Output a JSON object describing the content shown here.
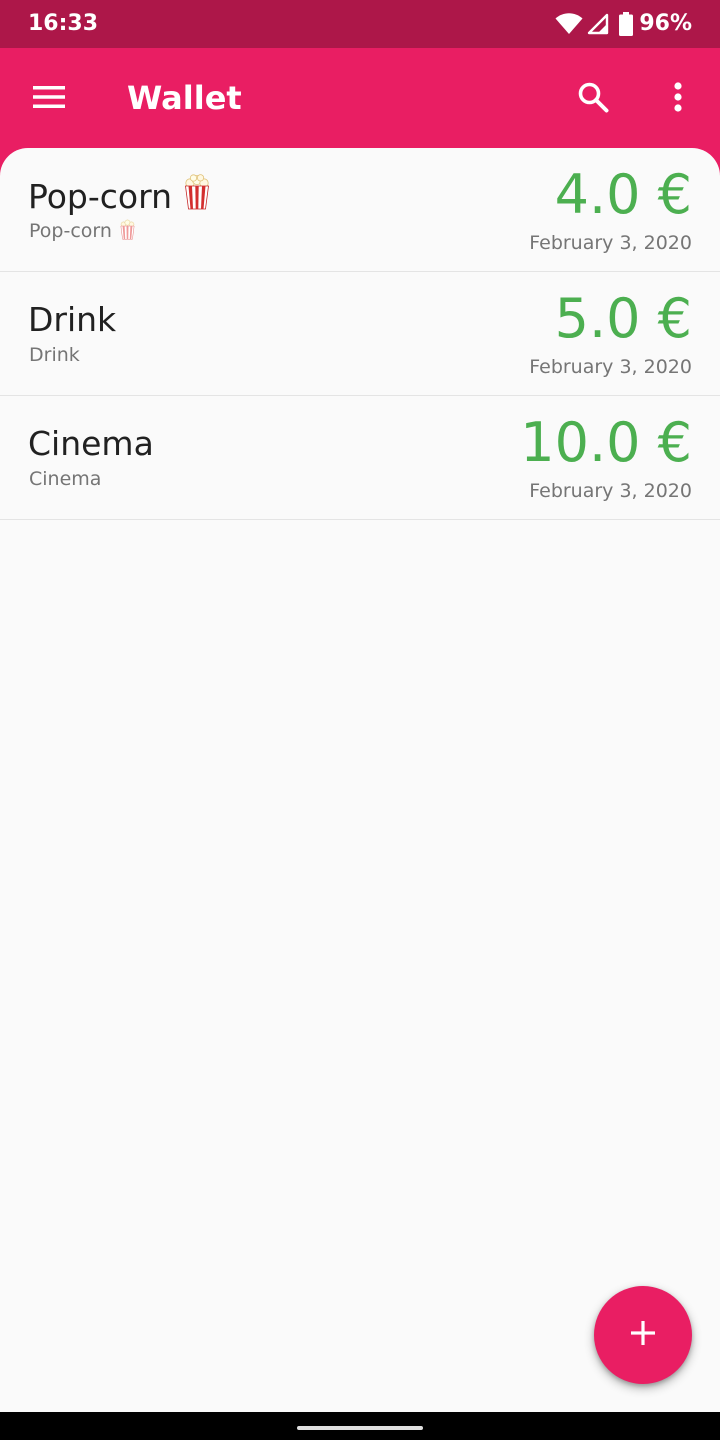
{
  "status_bar": {
    "time": "16:33",
    "battery_percent": "96%",
    "icons": [
      "wifi-icon",
      "signal-icon",
      "battery-icon"
    ]
  },
  "app_bar": {
    "title": "Wallet",
    "icons": [
      "menu-icon",
      "search-icon",
      "more-vert-icon"
    ]
  },
  "entries": [
    {
      "title": "Pop-corn",
      "subtitle": "Pop-corn",
      "emoji_icon": "popcorn-icon",
      "amount": "4.0 €",
      "date": "February 3, 2020"
    },
    {
      "title": "Drink",
      "subtitle": "Drink",
      "amount": "5.0 €",
      "date": "February 3, 2020"
    },
    {
      "title": "Cinema",
      "subtitle": "Cinema",
      "amount": "10.0 €",
      "date": "February 3, 2020"
    }
  ],
  "fab": {
    "icon": "add-icon"
  },
  "colors": {
    "primary": "#e91e63",
    "status_bar": "#ad1749",
    "amount_positive": "#4caf50",
    "background": "#fafafa"
  }
}
